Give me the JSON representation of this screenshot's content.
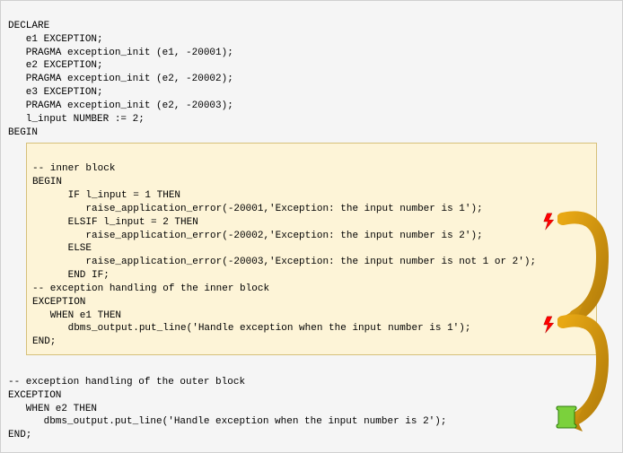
{
  "code": {
    "declare": "DECLARE",
    "e1": "   e1 EXCEPTION;",
    "pragma1": "   PRAGMA exception_init (e1, -20001);",
    "e2": "   e2 EXCEPTION;",
    "pragma2": "   PRAGMA exception_init (e2, -20002);",
    "e3": "   e3 EXCEPTION;",
    "pragma3": "   PRAGMA exception_init (e2, -20003);",
    "linput": "   l_input NUMBER := 2;",
    "begin": "BEGIN",
    "inner_cmt": "-- inner block",
    "inner_begin": "BEGIN",
    "if1": "      IF l_input = 1 THEN",
    "raise1": "         raise_application_error(-20001,'Exception: the input number is 1');",
    "elsif": "      ELSIF l_input = 2 THEN",
    "raise2": "         raise_application_error(-20002,'Exception: the input number is 2');",
    "else": "      ELSE",
    "raise3": "         raise_application_error(-20003,'Exception: the input number is not 1 or 2');",
    "endif": "      END IF;",
    "exc_cmt": "-- exception handling of the inner block",
    "exception": "EXCEPTION",
    "when_e1": "   WHEN e1 THEN",
    "dbms1": "      dbms_output.put_line('Handle exception when the input number is 1');",
    "inner_end": "END;",
    "outer_exc_cmt": "-- exception handling of the outer block",
    "outer_exception": "EXCEPTION",
    "when_e2": "   WHEN e2 THEN",
    "dbms2": "      dbms_output.put_line('Handle exception when the input number is 2');",
    "outer_end": "END;"
  }
}
